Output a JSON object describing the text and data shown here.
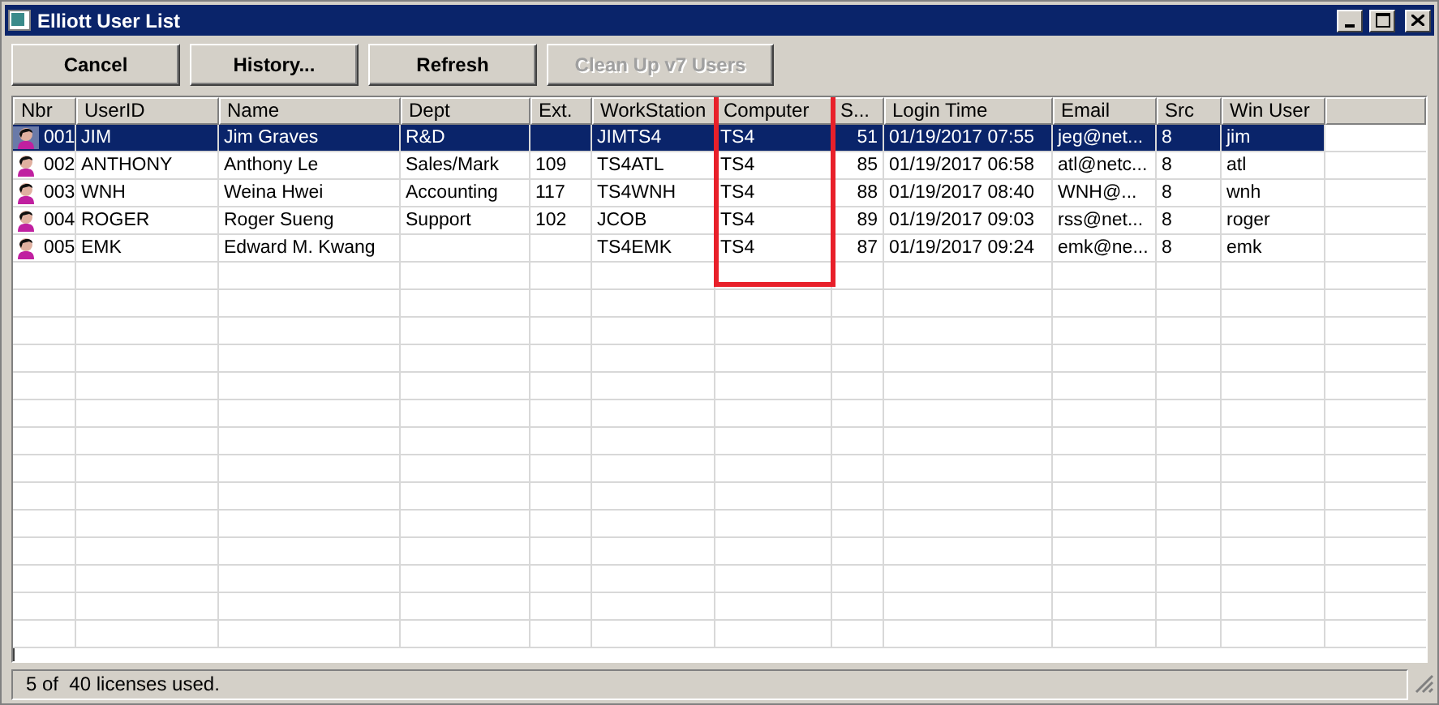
{
  "window": {
    "title": "Elliott User List"
  },
  "buttons": [
    {
      "label": "Cancel",
      "disabled": false
    },
    {
      "label": "History...",
      "disabled": false
    },
    {
      "label": "Refresh",
      "disabled": false
    },
    {
      "label": "Clean Up v7 Users",
      "disabled": true
    }
  ],
  "table": {
    "columns": [
      {
        "label": "Nbr",
        "highlighted": false
      },
      {
        "label": "UserID",
        "highlighted": false
      },
      {
        "label": "Name",
        "highlighted": false
      },
      {
        "label": "Dept",
        "highlighted": false
      },
      {
        "label": "Ext.",
        "highlighted": false
      },
      {
        "label": "WorkStation",
        "highlighted": false
      },
      {
        "label": "Computer",
        "highlighted": true
      },
      {
        "label": "S...",
        "highlighted": false
      },
      {
        "label": "Login Time",
        "highlighted": false
      },
      {
        "label": "Email",
        "highlighted": false
      },
      {
        "label": "Src",
        "highlighted": false
      },
      {
        "label": "Win User",
        "highlighted": false
      }
    ],
    "rows": [
      {
        "selected": true,
        "cells": [
          "001",
          "JIM",
          "Jim Graves",
          "R&D",
          "",
          "JIMTS4",
          "TS4",
          "51",
          "01/19/2017 07:55",
          "jeg@net...",
          "8",
          "jim"
        ]
      },
      {
        "selected": false,
        "cells": [
          "002",
          "ANTHONY",
          "Anthony Le",
          "Sales/Mark",
          "109",
          "TS4ATL",
          "TS4",
          "85",
          "01/19/2017 06:58",
          "atl@netc...",
          "8",
          "atl"
        ]
      },
      {
        "selected": false,
        "cells": [
          "003",
          "WNH",
          "Weina Hwei",
          "Accounting",
          "117",
          "TS4WNH",
          "TS4",
          "88",
          "01/19/2017 08:40",
          "WNH@...",
          "8",
          "wnh"
        ]
      },
      {
        "selected": false,
        "cells": [
          "004",
          "ROGER",
          "Roger Sueng",
          "Support",
          "102",
          "JCOB",
          "TS4",
          "89",
          "01/19/2017 09:03",
          "rss@net...",
          "8",
          "roger"
        ]
      },
      {
        "selected": false,
        "cells": [
          "005",
          "EMK",
          "Edward M. Kwang",
          "",
          "",
          "TS4EMK",
          "TS4",
          "87",
          "01/19/2017 09:24",
          "emk@ne...",
          "8",
          "emk"
        ]
      }
    ]
  },
  "status_bar": "5 of  40 licenses used."
}
